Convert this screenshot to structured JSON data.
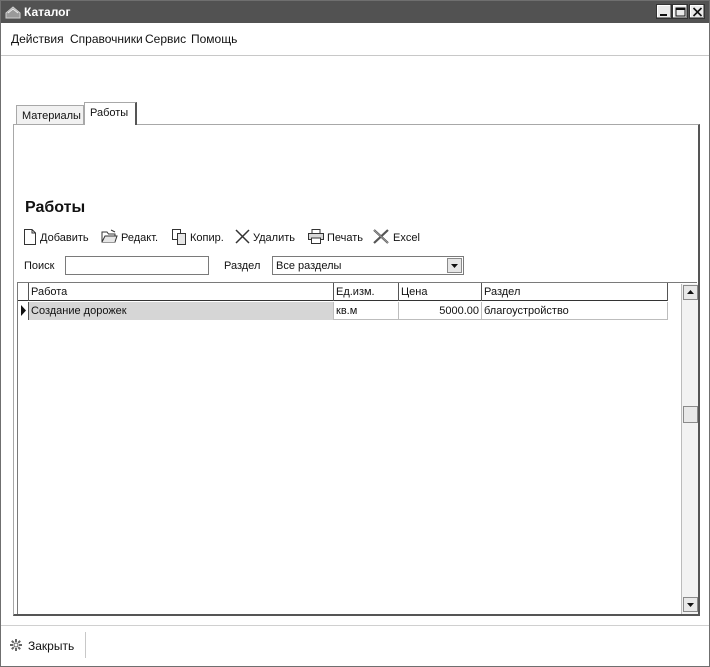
{
  "window": {
    "title": "Каталог"
  },
  "menu": {
    "items": [
      {
        "label": "Действия"
      },
      {
        "label": "Справочники"
      },
      {
        "label": "Сервис"
      },
      {
        "label": "Помощь"
      }
    ]
  },
  "tabs": [
    {
      "label": "Материалы",
      "active": false
    },
    {
      "label": "Работы",
      "active": true
    }
  ],
  "section": {
    "title": "Работы"
  },
  "toolbar": {
    "add_label": "Добавить",
    "edit_label": "Редакт.",
    "copy_label": "Копир.",
    "delete_label": "Удалить",
    "print_label": "Печать",
    "excel_label": "Excel"
  },
  "filters": {
    "search_label": "Поиск",
    "search_value": "",
    "section_label": "Раздел",
    "section_value": "Все разделы"
  },
  "grid": {
    "columns": [
      "Работа",
      "Ед.изм.",
      "Цена",
      "Раздел"
    ],
    "rows": [
      {
        "work": "Создание дорожек",
        "unit": "кв.м",
        "price": "5000.00",
        "section": "благоустройство",
        "selected": true
      }
    ]
  },
  "footer": {
    "close_label": "Закрыть"
  },
  "colors": {
    "titlebar": "#525252",
    "selection": "#d6d6d6"
  }
}
